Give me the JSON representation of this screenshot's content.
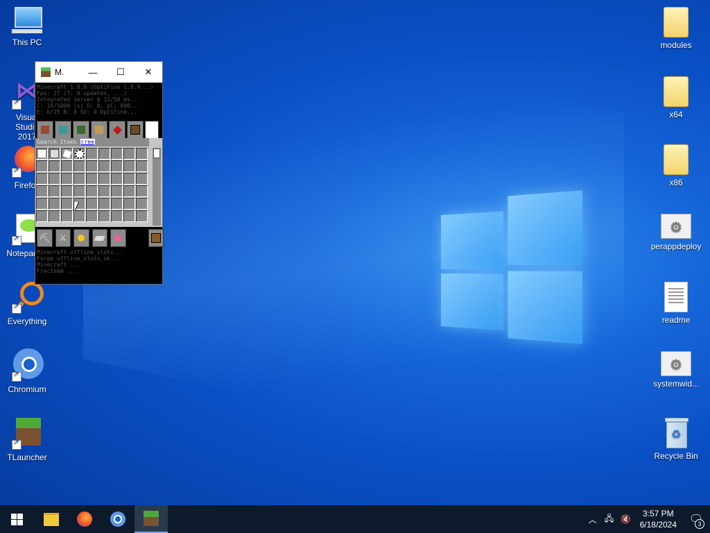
{
  "desktop": {
    "left_icons": [
      {
        "label": "This PC"
      },
      {
        "label": "Visual Studio 2017"
      },
      {
        "label": "Firefox"
      },
      {
        "label": "Notepad++"
      },
      {
        "label": "Everything"
      },
      {
        "label": "Chromium"
      },
      {
        "label": "TLauncher"
      }
    ],
    "right_icons": [
      {
        "label": "modules"
      },
      {
        "label": "x64"
      },
      {
        "label": "x86"
      },
      {
        "label": "perappdeploy"
      },
      {
        "label": "readme"
      },
      {
        "label": "systemwid..."
      },
      {
        "label": "Recycle Bin"
      }
    ]
  },
  "mc_window": {
    "title": "M.",
    "minimize": "—",
    "maximize": "☐",
    "close": "✕",
    "log_top": [
      "Minecraft 1.8.9 (OptiFine 1.8.9...)",
      "Fps: 27 (T: 0 updates, ...)",
      "Integrated server @ 12/50 ms...",
      "C: 16/5000 (s) D: 8, pC: 000...",
      "E: 0/25 B: 0 SU: 0 OptiFine..."
    ],
    "search_label": "Search Items",
    "search_query": "cree",
    "log_bottom": [
      "Minecraft.offline_slots...",
      "Forge offline_slots_ok...",
      "Minecraft ...",
      "Fracteam ..."
    ]
  },
  "taskbar": {
    "time": "3:57 PM",
    "date": "6/18/2024",
    "notification_count": "3"
  },
  "colors": {
    "desktop_bg": "#0a4fc4",
    "taskbar_bg": "#0d1a2b"
  }
}
